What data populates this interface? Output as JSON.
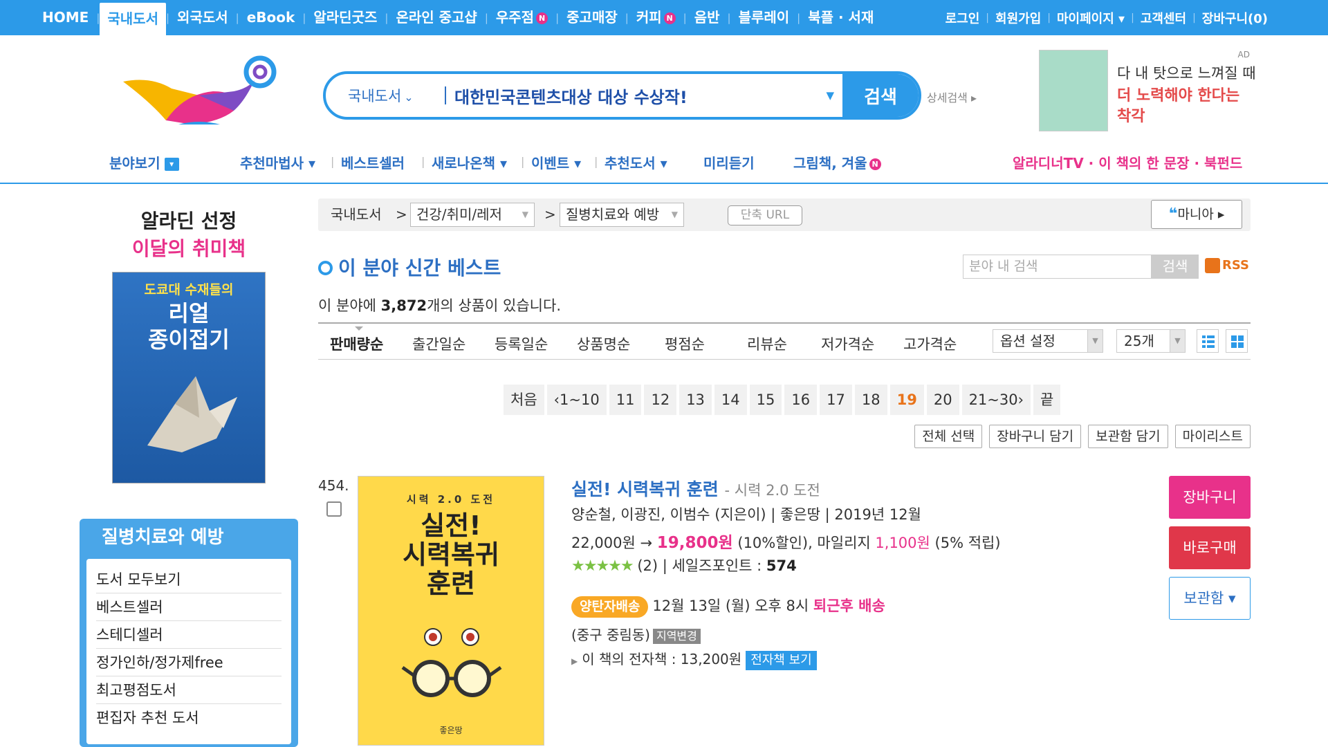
{
  "top_nav": {
    "items": [
      "HOME",
      "국내도서",
      "외국도서",
      "eBook",
      "알라딘굿즈",
      "온라인 중고샵",
      "우주점",
      "중고매장",
      "커피",
      "음반",
      "블루레이",
      "북플 · 서재"
    ],
    "active": "국내도서",
    "new_badge": "N"
  },
  "top_util": [
    "로그인",
    "회원가입",
    "마이페이지 ▾",
    "고객센터",
    "장바구니(0)"
  ],
  "search": {
    "category": "국내도서",
    "query": "대한민국콘텐츠대상 대상 수상작!",
    "button": "검색",
    "detail": "상세검색 ▸"
  },
  "ad": {
    "mark": "AD",
    "line1": "다 내 탓으로 느껴질 때",
    "line2": "더 노력해야 한다는",
    "line3": "착각"
  },
  "gnb": {
    "category": "분야보기",
    "items": [
      "추천마법사 ▾",
      "베스트셀러",
      "새로나온책 ▾",
      "이벤트 ▾",
      "추천도서 ▾",
      "미리듣기",
      "그림책, 겨울"
    ],
    "right": "알라디너TV · 이 책의 한 문장 · 북펀드"
  },
  "sidebar": {
    "pick_title1": "알라딘 선정",
    "pick_title2": "이달의 취미책",
    "pick_cover_top": "도쿄대 수재들의",
    "pick_cover_main1": "리얼",
    "pick_cover_main2": "종이접기",
    "category_title": "질병치료와 예방",
    "category_items": [
      "도서 모두보기",
      "베스트셀러",
      "스테디셀러",
      "정가인하/정가제free",
      "최고평점도서",
      "편집자 추천 도서"
    ]
  },
  "breadcrumb": {
    "root": "국내도서",
    "level1": "건강/취미/레저",
    "level2": "질병치료와 예방",
    "short_url": "단축 URL",
    "mania": "마니아 ▸"
  },
  "section": {
    "title": "이 분야 신간 베스트",
    "search_placeholder": "분야 내 검색",
    "search_button": "검색",
    "rss": "RSS",
    "count_prefix": "이 분야에",
    "count_value": "3,872",
    "count_suffix": "개의 상품이 있습니다."
  },
  "sort": {
    "options": [
      "판매량순",
      "출간일순",
      "등록일순",
      "상품명순",
      "평점순",
      "리뷰순",
      "저가격순",
      "고가격순"
    ],
    "active": "판매량순",
    "option_setting": "옵션 설정",
    "per_page": "25개"
  },
  "pager": {
    "first": "처음",
    "prev": "‹1~10",
    "pages": [
      "11",
      "12",
      "13",
      "14",
      "15",
      "16",
      "17",
      "18",
      "19",
      "20"
    ],
    "current": "19",
    "next": "21~30›",
    "last": "끝"
  },
  "actions": [
    "전체 선택",
    "장바구니 담기",
    "보관함 담기",
    "마이리스트"
  ],
  "item": {
    "rank": "454.",
    "title": "실전! 시력복귀 훈련",
    "subtitle": "- 시력 2.0 도전",
    "meta": "양순철, 이광진, 이범수 (지은이) | 좋은땅 | 2019년 12월",
    "price_original": "22,000원 →",
    "price_sale": "19,800원",
    "discount": "(10%할인), 마일리지",
    "mileage": "1,100원",
    "mileage_rate": "(5% 적립)",
    "stars": "★★★★★",
    "review_count": "(2) | 세일즈포인트 :",
    "sales_point": "574",
    "ship_tag": "양탄자배송",
    "ship_time": "12월 13일 (월) 오후 8시",
    "ship_note": "퇴근후 배송",
    "location": "(중구 중림동)",
    "location_change": "지역변경",
    "ebook_text": "이 책의 전자책 : 13,200원",
    "ebook_button": "전자책 보기",
    "cover_top": "시력 2.0 도전",
    "cover_main1": "실전!",
    "cover_main2": "시력복귀",
    "cover_main3": "훈련",
    "cover_pub": "좋은땅"
  },
  "item_buttons": {
    "cart": "장바구니",
    "buy": "바로구매",
    "keep": "보관함 ▾"
  },
  "colors": {
    "brand_blue": "#2c9ae8",
    "pink": "#e8318a",
    "orange": "#f9a825"
  }
}
